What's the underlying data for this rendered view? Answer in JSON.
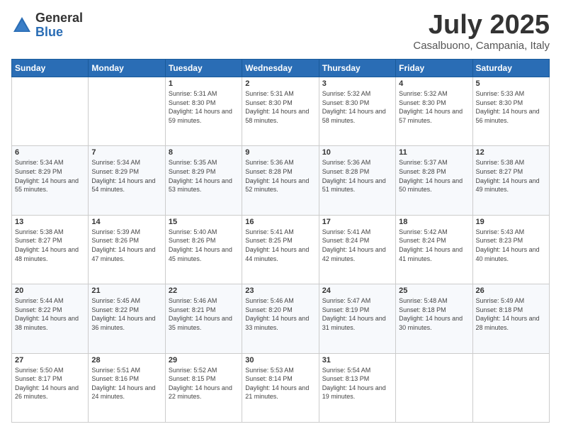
{
  "logo": {
    "general": "General",
    "blue": "Blue"
  },
  "header": {
    "month": "July 2025",
    "location": "Casalbuono, Campania, Italy"
  },
  "weekdays": [
    "Sunday",
    "Monday",
    "Tuesday",
    "Wednesday",
    "Thursday",
    "Friday",
    "Saturday"
  ],
  "weeks": [
    [
      {
        "day": "",
        "sunrise": "",
        "sunset": "",
        "daylight": ""
      },
      {
        "day": "",
        "sunrise": "",
        "sunset": "",
        "daylight": ""
      },
      {
        "day": "1",
        "sunrise": "Sunrise: 5:31 AM",
        "sunset": "Sunset: 8:30 PM",
        "daylight": "Daylight: 14 hours and 59 minutes."
      },
      {
        "day": "2",
        "sunrise": "Sunrise: 5:31 AM",
        "sunset": "Sunset: 8:30 PM",
        "daylight": "Daylight: 14 hours and 58 minutes."
      },
      {
        "day": "3",
        "sunrise": "Sunrise: 5:32 AM",
        "sunset": "Sunset: 8:30 PM",
        "daylight": "Daylight: 14 hours and 58 minutes."
      },
      {
        "day": "4",
        "sunrise": "Sunrise: 5:32 AM",
        "sunset": "Sunset: 8:30 PM",
        "daylight": "Daylight: 14 hours and 57 minutes."
      },
      {
        "day": "5",
        "sunrise": "Sunrise: 5:33 AM",
        "sunset": "Sunset: 8:30 PM",
        "daylight": "Daylight: 14 hours and 56 minutes."
      }
    ],
    [
      {
        "day": "6",
        "sunrise": "Sunrise: 5:34 AM",
        "sunset": "Sunset: 8:29 PM",
        "daylight": "Daylight: 14 hours and 55 minutes."
      },
      {
        "day": "7",
        "sunrise": "Sunrise: 5:34 AM",
        "sunset": "Sunset: 8:29 PM",
        "daylight": "Daylight: 14 hours and 54 minutes."
      },
      {
        "day": "8",
        "sunrise": "Sunrise: 5:35 AM",
        "sunset": "Sunset: 8:29 PM",
        "daylight": "Daylight: 14 hours and 53 minutes."
      },
      {
        "day": "9",
        "sunrise": "Sunrise: 5:36 AM",
        "sunset": "Sunset: 8:28 PM",
        "daylight": "Daylight: 14 hours and 52 minutes."
      },
      {
        "day": "10",
        "sunrise": "Sunrise: 5:36 AM",
        "sunset": "Sunset: 8:28 PM",
        "daylight": "Daylight: 14 hours and 51 minutes."
      },
      {
        "day": "11",
        "sunrise": "Sunrise: 5:37 AM",
        "sunset": "Sunset: 8:28 PM",
        "daylight": "Daylight: 14 hours and 50 minutes."
      },
      {
        "day": "12",
        "sunrise": "Sunrise: 5:38 AM",
        "sunset": "Sunset: 8:27 PM",
        "daylight": "Daylight: 14 hours and 49 minutes."
      }
    ],
    [
      {
        "day": "13",
        "sunrise": "Sunrise: 5:38 AM",
        "sunset": "Sunset: 8:27 PM",
        "daylight": "Daylight: 14 hours and 48 minutes."
      },
      {
        "day": "14",
        "sunrise": "Sunrise: 5:39 AM",
        "sunset": "Sunset: 8:26 PM",
        "daylight": "Daylight: 14 hours and 47 minutes."
      },
      {
        "day": "15",
        "sunrise": "Sunrise: 5:40 AM",
        "sunset": "Sunset: 8:26 PM",
        "daylight": "Daylight: 14 hours and 45 minutes."
      },
      {
        "day": "16",
        "sunrise": "Sunrise: 5:41 AM",
        "sunset": "Sunset: 8:25 PM",
        "daylight": "Daylight: 14 hours and 44 minutes."
      },
      {
        "day": "17",
        "sunrise": "Sunrise: 5:41 AM",
        "sunset": "Sunset: 8:24 PM",
        "daylight": "Daylight: 14 hours and 42 minutes."
      },
      {
        "day": "18",
        "sunrise": "Sunrise: 5:42 AM",
        "sunset": "Sunset: 8:24 PM",
        "daylight": "Daylight: 14 hours and 41 minutes."
      },
      {
        "day": "19",
        "sunrise": "Sunrise: 5:43 AM",
        "sunset": "Sunset: 8:23 PM",
        "daylight": "Daylight: 14 hours and 40 minutes."
      }
    ],
    [
      {
        "day": "20",
        "sunrise": "Sunrise: 5:44 AM",
        "sunset": "Sunset: 8:22 PM",
        "daylight": "Daylight: 14 hours and 38 minutes."
      },
      {
        "day": "21",
        "sunrise": "Sunrise: 5:45 AM",
        "sunset": "Sunset: 8:22 PM",
        "daylight": "Daylight: 14 hours and 36 minutes."
      },
      {
        "day": "22",
        "sunrise": "Sunrise: 5:46 AM",
        "sunset": "Sunset: 8:21 PM",
        "daylight": "Daylight: 14 hours and 35 minutes."
      },
      {
        "day": "23",
        "sunrise": "Sunrise: 5:46 AM",
        "sunset": "Sunset: 8:20 PM",
        "daylight": "Daylight: 14 hours and 33 minutes."
      },
      {
        "day": "24",
        "sunrise": "Sunrise: 5:47 AM",
        "sunset": "Sunset: 8:19 PM",
        "daylight": "Daylight: 14 hours and 31 minutes."
      },
      {
        "day": "25",
        "sunrise": "Sunrise: 5:48 AM",
        "sunset": "Sunset: 8:18 PM",
        "daylight": "Daylight: 14 hours and 30 minutes."
      },
      {
        "day": "26",
        "sunrise": "Sunrise: 5:49 AM",
        "sunset": "Sunset: 8:18 PM",
        "daylight": "Daylight: 14 hours and 28 minutes."
      }
    ],
    [
      {
        "day": "27",
        "sunrise": "Sunrise: 5:50 AM",
        "sunset": "Sunset: 8:17 PM",
        "daylight": "Daylight: 14 hours and 26 minutes."
      },
      {
        "day": "28",
        "sunrise": "Sunrise: 5:51 AM",
        "sunset": "Sunset: 8:16 PM",
        "daylight": "Daylight: 14 hours and 24 minutes."
      },
      {
        "day": "29",
        "sunrise": "Sunrise: 5:52 AM",
        "sunset": "Sunset: 8:15 PM",
        "daylight": "Daylight: 14 hours and 22 minutes."
      },
      {
        "day": "30",
        "sunrise": "Sunrise: 5:53 AM",
        "sunset": "Sunset: 8:14 PM",
        "daylight": "Daylight: 14 hours and 21 minutes."
      },
      {
        "day": "31",
        "sunrise": "Sunrise: 5:54 AM",
        "sunset": "Sunset: 8:13 PM",
        "daylight": "Daylight: 14 hours and 19 minutes."
      },
      {
        "day": "",
        "sunrise": "",
        "sunset": "",
        "daylight": ""
      },
      {
        "day": "",
        "sunrise": "",
        "sunset": "",
        "daylight": ""
      }
    ]
  ]
}
